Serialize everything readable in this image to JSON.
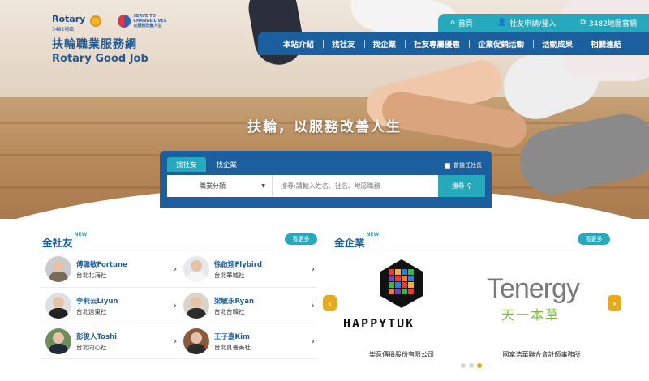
{
  "logo": {
    "rotary": "Rotary",
    "district": "3482地區",
    "serve": "SERVE TO CHANGE LIVES",
    "serve_cn": "以服務改變人生",
    "name_cn": "扶輪職業服務網",
    "name_en": "Rotary Good Job"
  },
  "util_bar": [
    {
      "icon": "home-icon",
      "label": "首頁"
    },
    {
      "icon": "user-icon",
      "label": "社友申請/登入"
    },
    {
      "icon": "external-link-icon",
      "label": "3482地區官網"
    }
  ],
  "nav": [
    "本站介紹",
    "找社友",
    "找企業",
    "社友專屬優惠",
    "企業促銷活動",
    "活動成果",
    "相關連結"
  ],
  "slogan": "扶輪，以服務改善人生",
  "search": {
    "tabs": [
      "找社友",
      "找企業"
    ],
    "active_tab": 0,
    "checkbox_label": "曾擔任社長",
    "category": "職業分類",
    "placeholder": "搜尋:請輸入姓名、社名、地區職務",
    "button": "搜尋"
  },
  "gold_members": {
    "title": "金社友",
    "badge": "NEW",
    "more": "看更多",
    "members": [
      {
        "name": "傅聰敏Fortune",
        "club": "台北北海社"
      },
      {
        "name": "徐啟翔Flybird",
        "club": "台北華城社"
      },
      {
        "name": "李莉云Liyun",
        "club": "台北遠東社"
      },
      {
        "name": "梁敏永Ryan",
        "club": "台北台韓社"
      },
      {
        "name": "彭俊人Toshi",
        "club": "台北同心社"
      },
      {
        "name": "王子嘉Kim",
        "club": "台北真善美社"
      }
    ]
  },
  "gold_companies": {
    "title": "金企業",
    "badge": "NEW",
    "more": "看更多",
    "companies": [
      {
        "logo_text": "HAPPYTUK",
        "caption": "樂意傳播股份有限公司"
      },
      {
        "logo_text": "Tenergy",
        "logo_sub": "天一本草",
        "caption": "國富浩華聯合會計師事務所"
      }
    ],
    "page": 3,
    "pages": 3
  },
  "colors": {
    "navy": "#1b5f9e",
    "teal": "#27a9bd",
    "gold": "#e8a91f"
  }
}
